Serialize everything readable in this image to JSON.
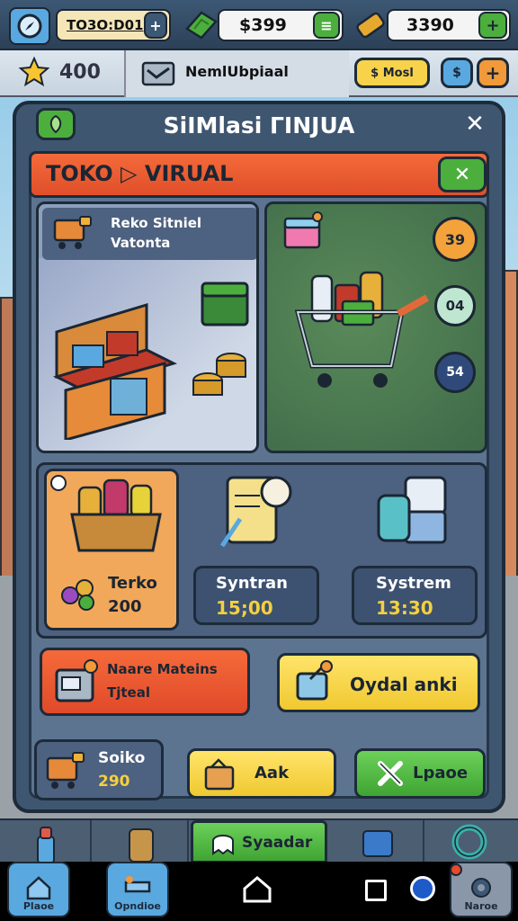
{
  "topbar": {
    "pill1_label": "TO3O:D01",
    "pill1_action": "+",
    "cash_value": "$399",
    "cash_add": "≡",
    "gold_value": "3390",
    "gold_add": "+"
  },
  "secondbar": {
    "stars_value": "400",
    "mission_label": "NemlUbpiaal",
    "reward_label": "$ Mosl",
    "small_btn_label": "$",
    "plus_label": "+"
  },
  "panel": {
    "title": "SiIMlasi ΓINJUA",
    "close_label": "✕",
    "shop_title": "TOKO ▷ VIRUAL",
    "shop_close": "✕"
  },
  "cards": {
    "store_title_1": "Reko Sitniel",
    "store_title_2": "Vatonta",
    "cart_badges": [
      "39",
      "04",
      "54"
    ]
  },
  "items": [
    {
      "label": "Terko",
      "value": "200"
    },
    {
      "label": "Syntran",
      "value": "15;00"
    },
    {
      "label": "Systrem",
      "value": "13:30"
    }
  ],
  "actions": {
    "left_label_1": "Naare Mateins",
    "left_label_2": "Tjteal",
    "right_label": "Oydal anki"
  },
  "bottom": {
    "stock_label": "Soiko",
    "stock_value": "290",
    "ask_label": "Aak",
    "update_label": "Lpaoe"
  },
  "nav": {
    "active_label": "Syaadar"
  },
  "system": {
    "left_label": "Plaoe",
    "second_label": "Opndioe",
    "right_label": "Naroe"
  },
  "colors": {
    "accent_orange": "#f46a3a",
    "accent_green": "#4caf3d",
    "accent_yellow": "#f4d03f",
    "panel_blue": "#3f5670"
  }
}
